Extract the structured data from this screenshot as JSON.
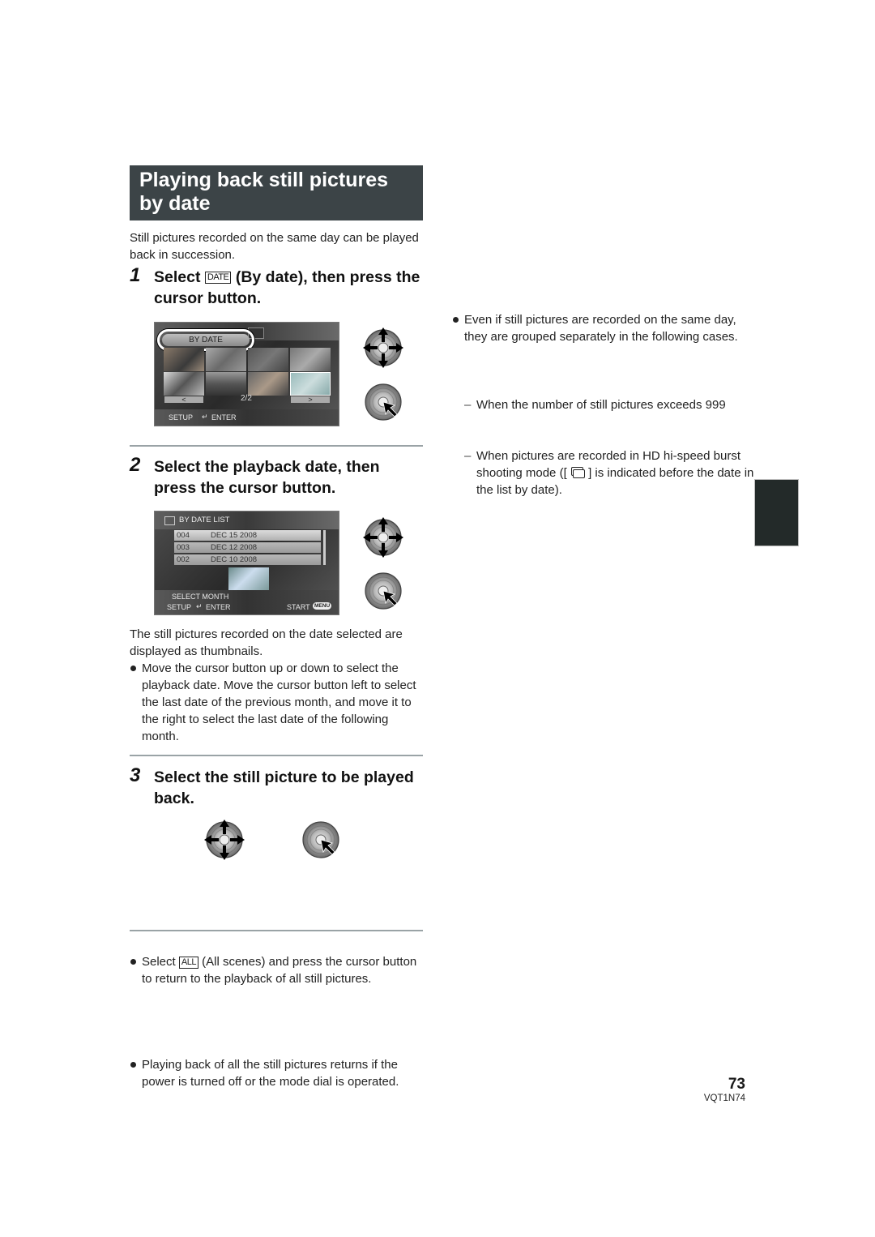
{
  "section": {
    "title_line1": "Playing back still pictures",
    "title_line2": "by date",
    "intro": "Still pictures recorded on the same day can be played back in succession."
  },
  "steps": [
    {
      "number": "1",
      "text_before": "Select",
      "icon_label": "DATE",
      "text_after": "(By date), then press the cursor button.",
      "screen": {
        "pill_label": "BY DATE",
        "page_indicator": "2/2",
        "prev_label": "<",
        "next_label": ">",
        "footer_left": "SETUP",
        "footer_right": "ENTER"
      }
    },
    {
      "number": "2",
      "text": "Select the playback date, then press the cursor button.",
      "screen": {
        "header": "BY DATE LIST",
        "rows": [
          {
            "no": "004",
            "date": "DEC 15 2008"
          },
          {
            "no": "003",
            "date": "DEC 12 2008"
          },
          {
            "no": "002",
            "date": "DEC 10 2008"
          }
        ],
        "footer_line1": "SELECT MONTH",
        "footer_left": "SETUP",
        "footer_mid": "ENTER",
        "footer_right": "START",
        "menu_badge": "MENU"
      },
      "description": "The still pictures recorded on the date selected are displayed as thumbnails.",
      "bullets": [
        "Move the cursor button up or down to select the playback date. Move the cursor button left to select the last date of the previous month, and move it to the right to select the last date of the following month."
      ]
    },
    {
      "number": "3",
      "text": "Select the still picture to be played back.",
      "bullet_before": "Select",
      "bullet_icon_label": "ALL",
      "bullet_after": "(All scenes) and press the cursor button to return to the playback of all still pictures."
    }
  ],
  "note_left": "Playing back of all the still pictures returns if the power is turned off or the mode dial is operated.",
  "right_column": {
    "bullet": "Even if still pictures are recorded on the same day, they are grouped separately in the following cases.",
    "dash_items": [
      "When the number of still pictures exceeds 999",
      "When pictures are recorded in HD hi-speed burst shooting mode ([",
      "] is indicated before the date in the list by date)."
    ]
  },
  "icons": {
    "cursor_move": "cursor-button-4-way-icon",
    "cursor_press": "cursor-button-press-icon",
    "burst": "burst-shooting-icon"
  },
  "footer": {
    "page_number": "73",
    "doc_code": "VQT1N74"
  },
  "colors": {
    "title_bg": "#3c4447",
    "tab_block": "#232a29",
    "rule": "#9aa3a6"
  }
}
